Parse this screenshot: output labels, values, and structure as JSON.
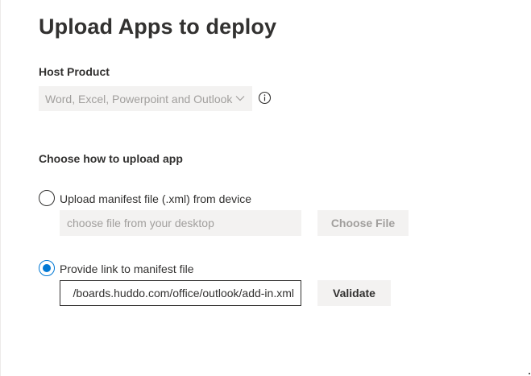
{
  "page": {
    "title": "Upload Apps to deploy"
  },
  "host_product": {
    "label": "Host Product",
    "selected": "Word, Excel, Powerpoint and Outlook",
    "chevron_icon": "chevron-down-icon",
    "info_icon": "info-icon"
  },
  "upload": {
    "heading": "Choose how to upload app",
    "option_device": {
      "label": "Upload manifest file (.xml) from device",
      "selected": false,
      "file_placeholder": "choose file from your desktop",
      "choose_file_label": "Choose File"
    },
    "option_link": {
      "label": "Provide link to manifest file",
      "selected": true,
      "link_value": "/boards.huddo.com/office/outlook/add-in.xml",
      "validate_label": "Validate"
    }
  },
  "colors": {
    "accent": "#0078d4",
    "disabled_bg": "#f3f2f1",
    "disabled_text": "#a19f9d",
    "text": "#323130"
  }
}
